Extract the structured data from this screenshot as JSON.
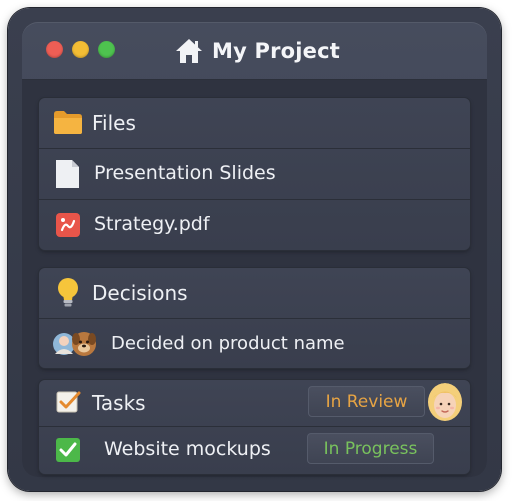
{
  "window": {
    "title": "My Project",
    "controls": [
      "close",
      "minimize",
      "zoom"
    ]
  },
  "files": {
    "heading": "Files",
    "heading_icon": "folder-icon",
    "items": [
      {
        "label": "Presentation Slides",
        "icon": "document-icon"
      },
      {
        "label": "Strategy.pdf",
        "icon": "pdf-icon"
      }
    ]
  },
  "decisions": {
    "heading": "Decisions",
    "heading_icon": "lightbulb-icon",
    "items": [
      {
        "label": "Decided on product name",
        "icon": "user-avatars-icon"
      }
    ]
  },
  "tasks": {
    "heading": "Tasks",
    "heading_icon": "checkbox-icon",
    "heading_status": "In Review",
    "items": [
      {
        "label": "Website mockups",
        "status": "In Progress",
        "done": true
      }
    ]
  },
  "colors": {
    "status_review": "#e7a444",
    "status_progress": "#79c25d",
    "accent_red": "#ee5e55",
    "accent_yellow": "#f3bd35",
    "accent_green": "#4ec24f"
  }
}
